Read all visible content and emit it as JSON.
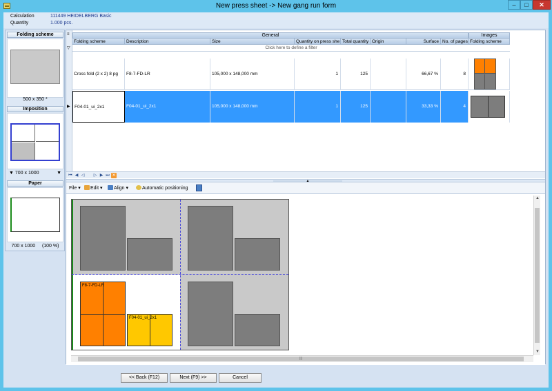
{
  "window": {
    "title": "New press sheet -> New gang run form",
    "minimize": "–",
    "maximize": "□",
    "close": "✕"
  },
  "info": {
    "calculation_label": "Calculation",
    "calculation_value": "111449 HEIDELBERG Basic",
    "quantity_label": "Quantity",
    "quantity_value": "1.000 pcs."
  },
  "left_panel": {
    "folding_scheme": {
      "header": "Folding scheme",
      "caption": "500 x 350 *"
    },
    "imposition": {
      "header": "Imposition",
      "caption": "700 x 1000"
    },
    "paper": {
      "header": "Paper",
      "caption_size": "700 x 1000",
      "caption_pct": "(100 %)"
    }
  },
  "grid": {
    "group_general": "General",
    "group_images": "Images",
    "filter_text": "Click here to define a filter",
    "columns": [
      "Folding scheme",
      "Description",
      "Size",
      "Quantity on press she",
      "Total quantity",
      "Origin",
      "Surface",
      "No. of pages",
      "Folding scheme"
    ],
    "rows": [
      {
        "folding_scheme": "Cross fold (2 x 2)  8 pg",
        "description": "F8-7-FD-LR",
        "size": "105,000 x  148,000 mm",
        "qty_on_sheet": "1",
        "total_qty": "125",
        "origin": "",
        "surface": "66,67 %",
        "pages": "8"
      },
      {
        "folding_scheme": "F04-01_ui_2x1",
        "description": "F04-01_ui_2x1",
        "size": "105,000 x  148,000 mm",
        "qty_on_sheet": "1",
        "total_qty": "125",
        "origin": "",
        "surface": "33,33 %",
        "pages": "4"
      }
    ],
    "nav": [
      "⏮",
      "◀",
      "◁",
      "▷",
      "▶",
      "⏭",
      "✕"
    ]
  },
  "toolbar": {
    "file": "File",
    "edit": "Edit",
    "align": "Align",
    "auto_pos": "Automatic positioning"
  },
  "canvas": {
    "job1_label": "F8-7-FD-LR",
    "job2_label": "F04-01_ui_2x1"
  },
  "buttons": {
    "back": "<< Back (F12)",
    "next": "Next (F9) >>",
    "cancel": "Cancel"
  },
  "colors": {
    "titlebar": "#5ec3ea",
    "selection": "#3399ff",
    "job_orange": "#ff8000",
    "job_yellow": "#ffc800",
    "sheet_gray": "#c9c9c9",
    "page_gray": "#7d7d7d"
  }
}
